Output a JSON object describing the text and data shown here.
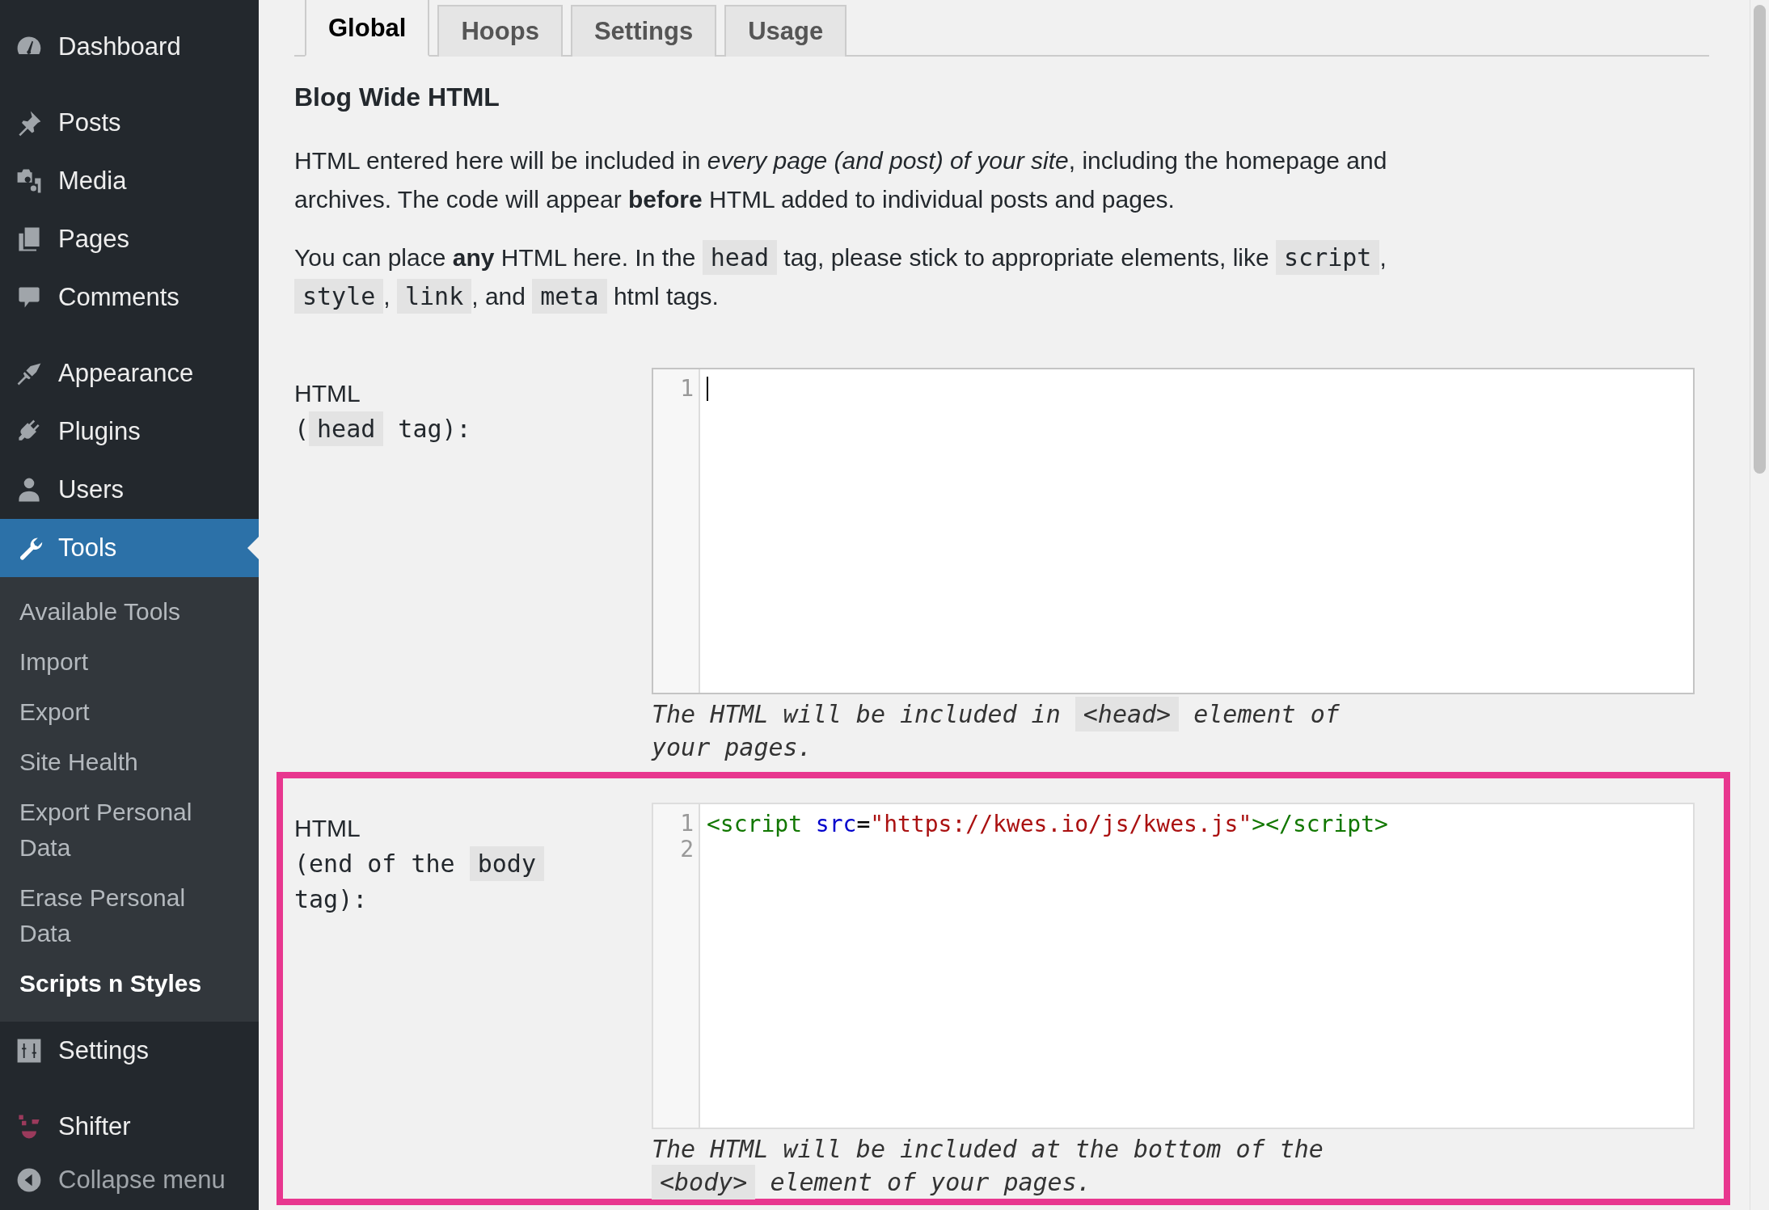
{
  "sidebar": {
    "groups": [
      [
        {
          "label": "Dashboard",
          "selected": false
        }
      ],
      [
        {
          "label": "Posts",
          "selected": false
        },
        {
          "label": "Media",
          "selected": false
        },
        {
          "label": "Pages",
          "selected": false
        },
        {
          "label": "Comments",
          "selected": false
        }
      ],
      [
        {
          "label": "Appearance",
          "selected": false
        },
        {
          "label": "Plugins",
          "selected": false
        },
        {
          "label": "Users",
          "selected": false
        },
        {
          "label": "Tools",
          "selected": true,
          "children": [
            {
              "label": "Available Tools",
              "selected": false
            },
            {
              "label": "Import",
              "selected": false
            },
            {
              "label": "Export",
              "selected": false
            },
            {
              "label": "Site Health",
              "selected": false
            },
            {
              "label": "Export Personal Data",
              "selected": false
            },
            {
              "label": "Erase Personal Data",
              "selected": false
            },
            {
              "label": "Scripts n Styles",
              "selected": true
            }
          ]
        },
        {
          "label": "Settings",
          "selected": false
        }
      ],
      [
        {
          "label": "Shifter",
          "selected": false
        }
      ]
    ],
    "collapse": "Collapse menu"
  },
  "tabs": [
    {
      "label": "Global",
      "selected": true
    },
    {
      "label": "Hoops",
      "selected": false
    },
    {
      "label": "Settings",
      "selected": false
    },
    {
      "label": "Usage",
      "selected": false
    }
  ],
  "heading": "Blog Wide HTML",
  "paragraphs": [
    [
      {
        "kind": "text",
        "text": "HTML entered here will be included in *every page (and post) of your site*, including the homepage and archives. The code will appear **before** HTML added to individual posts and pages."
      }
    ],
    [
      {
        "kind": "text",
        "text": "You can place **any** HTML here. In the "
      },
      {
        "kind": "code",
        "text": "head"
      },
      {
        "kind": "text",
        "text": " tag, please stick to appropriate elements, like "
      },
      {
        "kind": "code",
        "text": "script"
      },
      {
        "kind": "text",
        "text": ", "
      },
      {
        "kind": "code",
        "text": "style"
      },
      {
        "kind": "text",
        "text": ", "
      },
      {
        "kind": "code",
        "text": "link"
      },
      {
        "kind": "text",
        "text": ", and "
      },
      {
        "kind": "code",
        "text": "meta"
      },
      {
        "kind": "text",
        "text": " html tags."
      }
    ]
  ],
  "fields": [
    {
      "highlighted": false,
      "label_title": "HTML",
      "label": [
        {
          "kind": "text",
          "text": "("
        },
        {
          "kind": "code",
          "text": "head"
        },
        {
          "kind": "text",
          "text": " tag):"
        }
      ],
      "editor": {
        "focused": true,
        "lines": [
          {
            "number": "1"
          }
        ]
      },
      "description": [
        {
          "kind": "text",
          "text": "The HTML will be included in "
        },
        {
          "kind": "code",
          "text": "<head>"
        },
        {
          "kind": "text",
          "text": " element of your pages."
        }
      ]
    },
    {
      "highlighted": true,
      "label_title": "HTML",
      "label": [
        {
          "kind": "text",
          "text": "(end of the "
        },
        {
          "kind": "code",
          "text": "body"
        },
        {
          "kind": "text",
          "text": " tag):"
        }
      ],
      "editor": {
        "focused": false,
        "lines": [
          {
            "number": "1",
            "tokens": [
              {
                "kind": "tag",
                "text": "<script "
              },
              {
                "kind": "attr",
                "text": "src"
              },
              {
                "kind": "plain",
                "text": "="
              },
              {
                "kind": "string",
                "text": "\"https://kwes.io/js/kwes.js\""
              },
              {
                "kind": "tag",
                "text": "></script>"
              }
            ]
          },
          {
            "number": "2"
          }
        ]
      },
      "description": [
        {
          "kind": "text",
          "text": "The HTML will be included at the bottom of the "
        },
        {
          "kind": "code",
          "text": "<body>"
        },
        {
          "kind": "text",
          "text": " element of your pages."
        }
      ]
    }
  ]
}
